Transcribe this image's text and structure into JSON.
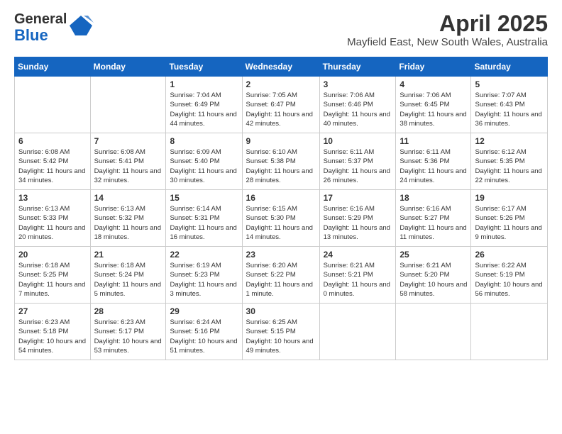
{
  "header": {
    "logo_general": "General",
    "logo_blue": "Blue",
    "month_year": "April 2025",
    "location": "Mayfield East, New South Wales, Australia"
  },
  "days_of_week": [
    "Sunday",
    "Monday",
    "Tuesday",
    "Wednesday",
    "Thursday",
    "Friday",
    "Saturday"
  ],
  "weeks": [
    [
      {
        "day": "",
        "info": ""
      },
      {
        "day": "",
        "info": ""
      },
      {
        "day": "1",
        "info": "Sunrise: 7:04 AM\nSunset: 6:49 PM\nDaylight: 11 hours and 44 minutes."
      },
      {
        "day": "2",
        "info": "Sunrise: 7:05 AM\nSunset: 6:47 PM\nDaylight: 11 hours and 42 minutes."
      },
      {
        "day": "3",
        "info": "Sunrise: 7:06 AM\nSunset: 6:46 PM\nDaylight: 11 hours and 40 minutes."
      },
      {
        "day": "4",
        "info": "Sunrise: 7:06 AM\nSunset: 6:45 PM\nDaylight: 11 hours and 38 minutes."
      },
      {
        "day": "5",
        "info": "Sunrise: 7:07 AM\nSunset: 6:43 PM\nDaylight: 11 hours and 36 minutes."
      }
    ],
    [
      {
        "day": "6",
        "info": "Sunrise: 6:08 AM\nSunset: 5:42 PM\nDaylight: 11 hours and 34 minutes."
      },
      {
        "day": "7",
        "info": "Sunrise: 6:08 AM\nSunset: 5:41 PM\nDaylight: 11 hours and 32 minutes."
      },
      {
        "day": "8",
        "info": "Sunrise: 6:09 AM\nSunset: 5:40 PM\nDaylight: 11 hours and 30 minutes."
      },
      {
        "day": "9",
        "info": "Sunrise: 6:10 AM\nSunset: 5:38 PM\nDaylight: 11 hours and 28 minutes."
      },
      {
        "day": "10",
        "info": "Sunrise: 6:11 AM\nSunset: 5:37 PM\nDaylight: 11 hours and 26 minutes."
      },
      {
        "day": "11",
        "info": "Sunrise: 6:11 AM\nSunset: 5:36 PM\nDaylight: 11 hours and 24 minutes."
      },
      {
        "day": "12",
        "info": "Sunrise: 6:12 AM\nSunset: 5:35 PM\nDaylight: 11 hours and 22 minutes."
      }
    ],
    [
      {
        "day": "13",
        "info": "Sunrise: 6:13 AM\nSunset: 5:33 PM\nDaylight: 11 hours and 20 minutes."
      },
      {
        "day": "14",
        "info": "Sunrise: 6:13 AM\nSunset: 5:32 PM\nDaylight: 11 hours and 18 minutes."
      },
      {
        "day": "15",
        "info": "Sunrise: 6:14 AM\nSunset: 5:31 PM\nDaylight: 11 hours and 16 minutes."
      },
      {
        "day": "16",
        "info": "Sunrise: 6:15 AM\nSunset: 5:30 PM\nDaylight: 11 hours and 14 minutes."
      },
      {
        "day": "17",
        "info": "Sunrise: 6:16 AM\nSunset: 5:29 PM\nDaylight: 11 hours and 13 minutes."
      },
      {
        "day": "18",
        "info": "Sunrise: 6:16 AM\nSunset: 5:27 PM\nDaylight: 11 hours and 11 minutes."
      },
      {
        "day": "19",
        "info": "Sunrise: 6:17 AM\nSunset: 5:26 PM\nDaylight: 11 hours and 9 minutes."
      }
    ],
    [
      {
        "day": "20",
        "info": "Sunrise: 6:18 AM\nSunset: 5:25 PM\nDaylight: 11 hours and 7 minutes."
      },
      {
        "day": "21",
        "info": "Sunrise: 6:18 AM\nSunset: 5:24 PM\nDaylight: 11 hours and 5 minutes."
      },
      {
        "day": "22",
        "info": "Sunrise: 6:19 AM\nSunset: 5:23 PM\nDaylight: 11 hours and 3 minutes."
      },
      {
        "day": "23",
        "info": "Sunrise: 6:20 AM\nSunset: 5:22 PM\nDaylight: 11 hours and 1 minute."
      },
      {
        "day": "24",
        "info": "Sunrise: 6:21 AM\nSunset: 5:21 PM\nDaylight: 11 hours and 0 minutes."
      },
      {
        "day": "25",
        "info": "Sunrise: 6:21 AM\nSunset: 5:20 PM\nDaylight: 10 hours and 58 minutes."
      },
      {
        "day": "26",
        "info": "Sunrise: 6:22 AM\nSunset: 5:19 PM\nDaylight: 10 hours and 56 minutes."
      }
    ],
    [
      {
        "day": "27",
        "info": "Sunrise: 6:23 AM\nSunset: 5:18 PM\nDaylight: 10 hours and 54 minutes."
      },
      {
        "day": "28",
        "info": "Sunrise: 6:23 AM\nSunset: 5:17 PM\nDaylight: 10 hours and 53 minutes."
      },
      {
        "day": "29",
        "info": "Sunrise: 6:24 AM\nSunset: 5:16 PM\nDaylight: 10 hours and 51 minutes."
      },
      {
        "day": "30",
        "info": "Sunrise: 6:25 AM\nSunset: 5:15 PM\nDaylight: 10 hours and 49 minutes."
      },
      {
        "day": "",
        "info": ""
      },
      {
        "day": "",
        "info": ""
      },
      {
        "day": "",
        "info": ""
      }
    ]
  ]
}
